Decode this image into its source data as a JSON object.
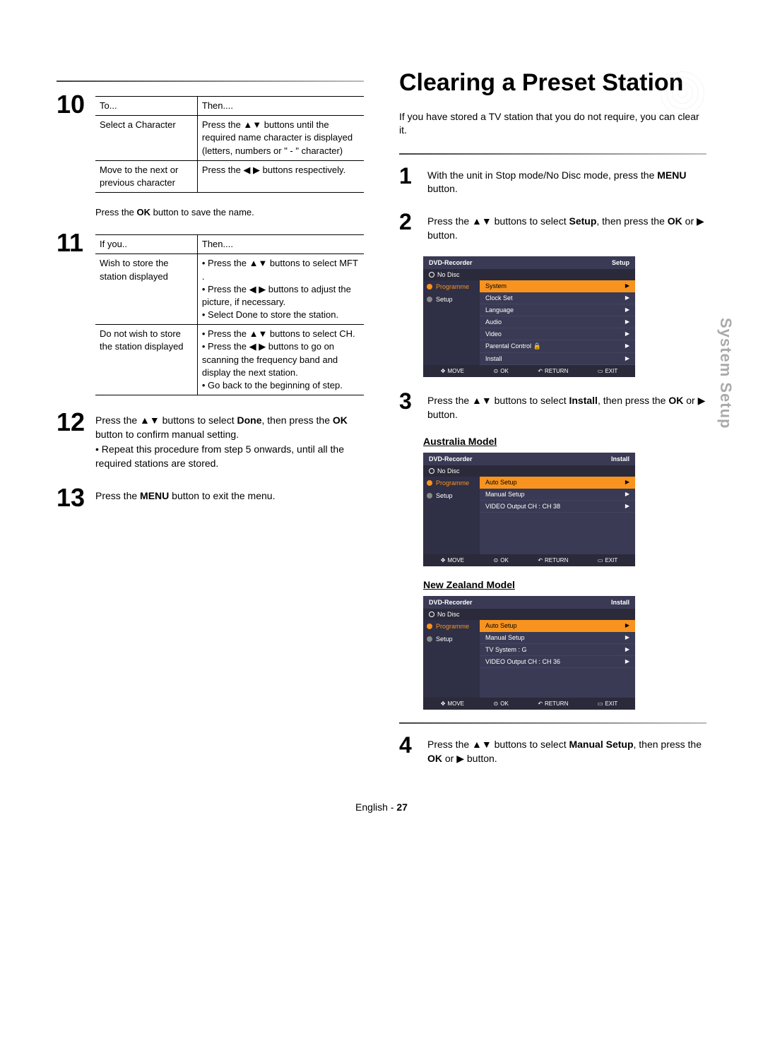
{
  "left": {
    "step10": {
      "num": "10",
      "table": {
        "h1": "To...",
        "h2": "Then....",
        "r1c1": "Select a Character",
        "r1c2": "Press the ▲▼ buttons until the required name character is displayed (letters, numbers or \" - \" character)",
        "r2c1": "Move to the next or previous character",
        "r2c2": "Press the ◀ ▶ buttons respectively."
      },
      "note": "Press the OK button to save the name."
    },
    "step11": {
      "num": "11",
      "table": {
        "h1": "If you..",
        "h2": "Then....",
        "r1c1": "Wish to store the station displayed",
        "r1c2a": "• Press the ▲▼ buttons to select MFT .",
        "r1c2b": "• Press the ◀ ▶ buttons to adjust the picture, if necessary.",
        "r1c2c": "• Select Done to store the station.",
        "r2c1": "Do not wish to store the station displayed",
        "r2c2a": "• Press the ▲▼ buttons to select CH.",
        "r2c2b": "• Press the ◀ ▶ buttons to go on scanning the frequency band and display the next station.",
        "r2c2c": "• Go back to the beginning of step."
      }
    },
    "step12": {
      "num": "12",
      "line1a": "Press the ▲▼ buttons to select ",
      "line1b": "Done",
      "line1c": ", then press the ",
      "line1d": "OK",
      "line1e": " button to confirm manual setting.",
      "line2": "• Repeat this procedure from step 5 onwards, until all the required stations are stored."
    },
    "step13": {
      "num": "13",
      "text1": "Press the ",
      "text2": "MENU",
      "text3": " button to exit the menu."
    }
  },
  "right": {
    "title": "Clearing a Preset Station",
    "intro": "If you have stored a TV station that you do not require, you can clear it.",
    "step1": {
      "num": "1",
      "a": "With the unit in Stop mode/No Disc mode, press the ",
      "b": "MENU",
      "c": " button."
    },
    "step2": {
      "num": "2",
      "a": "Press the ▲▼ buttons to select ",
      "b": "Setup",
      "c": ", then press the ",
      "d": "OK",
      "e": " or ▶ button."
    },
    "step3": {
      "num": "3",
      "a": "Press the ▲▼ buttons to select ",
      "b": "Install",
      "c": ", then press the ",
      "d": "OK",
      "e": " or ▶ button."
    },
    "aus_label": "Australia Model",
    "nz_label": "New Zealand Model",
    "step4": {
      "num": "4",
      "a": "Press the ▲▼ buttons to select ",
      "b": "Manual Setup",
      "c": ", then press the ",
      "d": "OK",
      "e": " or ▶ button."
    }
  },
  "osd1": {
    "title": "DVD-Recorder",
    "corner": "Setup",
    "sub": "No Disc",
    "left1": "Programme",
    "left2": "Setup",
    "rows": [
      "System",
      "Clock Set",
      "Language",
      "Audio",
      "Video",
      "Parental Control 🔒",
      "Install"
    ]
  },
  "osd2": {
    "title": "DVD-Recorder",
    "corner": "Install",
    "sub": "No Disc",
    "left1": "Programme",
    "left2": "Setup",
    "rows": [
      "Auto Setup",
      "Manual Setup",
      "VIDEO Output CH   : CH 38"
    ]
  },
  "osd3": {
    "title": "DVD-Recorder",
    "corner": "Install",
    "sub": "No Disc",
    "left1": "Programme",
    "left2": "Setup",
    "rows": [
      "Auto Setup",
      "Manual Setup",
      "TV System   : G",
      "VIDEO Output CH   : CH 36"
    ]
  },
  "osd_footer": {
    "move": "MOVE",
    "ok": "OK",
    "return": "RETURN",
    "exit": "EXIT"
  },
  "tab": "System Setup",
  "footer": {
    "lang": "English -",
    "page": "27"
  }
}
